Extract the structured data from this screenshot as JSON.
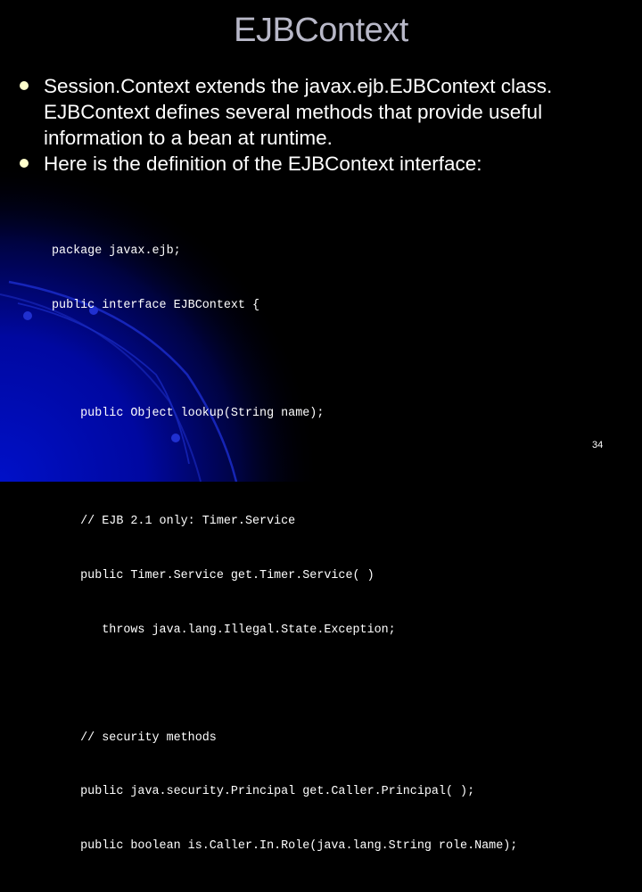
{
  "slide": {
    "title": "EJBContext",
    "bullets": [
      {
        "text": "Session.Context extends the javax.ejb.EJBContext class. EJBContext defines several methods that provide useful information to a bean at runtime."
      },
      {
        "text": "Here is the definition of the EJBContext interface:"
      }
    ],
    "code_lines": [
      "package javax.ejb;",
      "public interface EJBContext {",
      "",
      "    public Object lookup(String name);",
      "",
      "    // EJB 2.1 only: Timer.Service",
      "    public Timer.Service get.Timer.Service( )",
      "       throws java.lang.Illegal.State.Exception;",
      "",
      "    // security methods",
      "    public java.security.Principal get.Caller.Principal( );",
      "    public boolean is.Caller.In.Role(java.lang.String role.Name);"
    ],
    "page_number": "34",
    "colors": {
      "background": "#000000",
      "title": "#b8b8c8",
      "body_text": "#ffffff",
      "bullet": "#ffffcc",
      "accent_blue": "#0a14c8"
    }
  }
}
